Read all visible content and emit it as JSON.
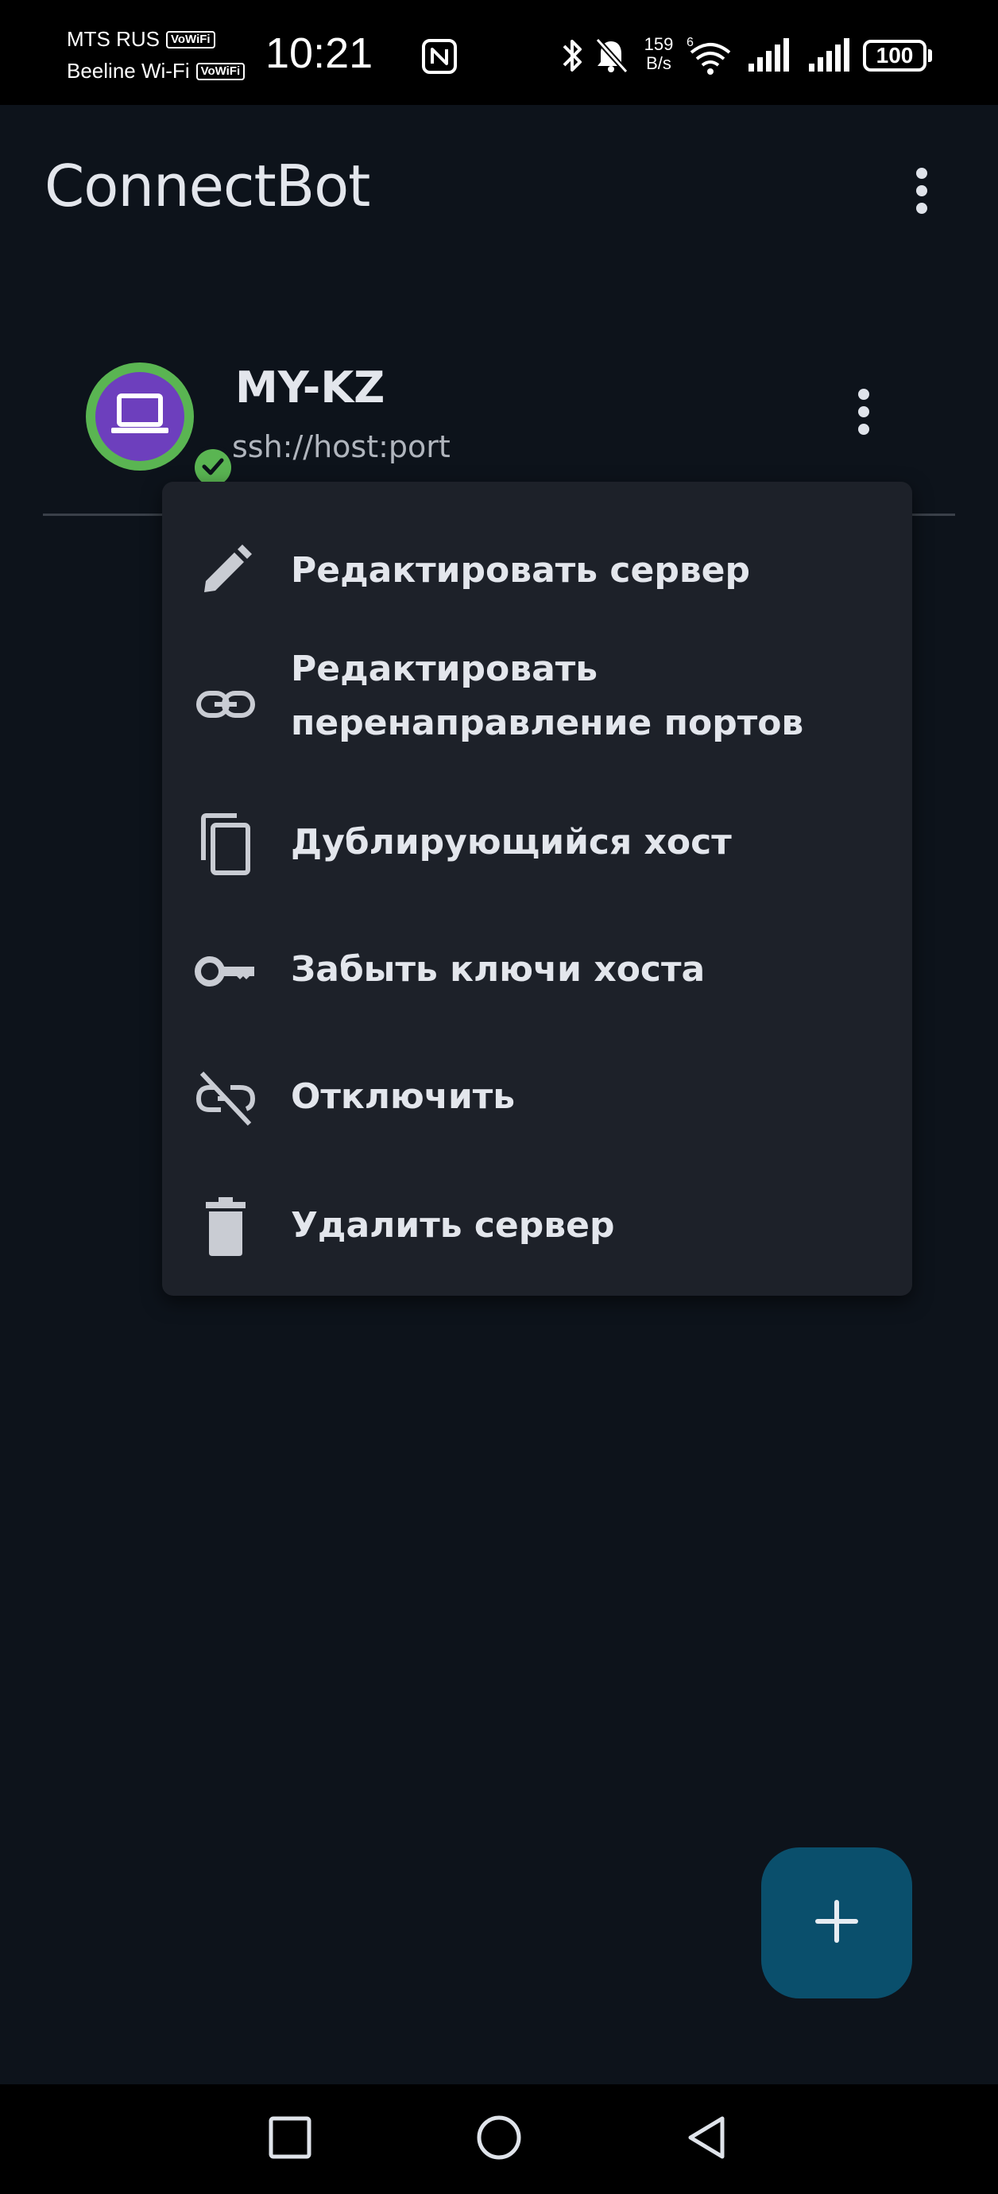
{
  "status_bar": {
    "carrier_1": "MTS RUS",
    "carrier_2": "Beeline Wi-Fi",
    "vowifi_badge": "VoWiFi",
    "time": "10:21",
    "net_speed_value": "159",
    "net_speed_unit": "B/s",
    "wifi_badge": "6",
    "battery": "100"
  },
  "app_bar": {
    "title": "ConnectBot",
    "overflow_icon": "more-vert-icon"
  },
  "host": {
    "name": "MY-KZ",
    "uri": "ssh://host:port",
    "status": "connected",
    "avatar_color": "#6d3fbd",
    "status_color": "#5ab552"
  },
  "context_menu": {
    "items": [
      {
        "label": "Редактировать сервер",
        "icon": "pencil-icon"
      },
      {
        "label": "Редактировать\nперенаправление портов",
        "icon": "link-icon"
      },
      {
        "label": "Дублирующийся хост",
        "icon": "copy-icon"
      },
      {
        "label": "Забыть ключи хоста",
        "icon": "key-icon"
      },
      {
        "label": "Отключить",
        "icon": "link-off-icon"
      },
      {
        "label": "Удалить сервер",
        "icon": "trash-icon"
      }
    ]
  },
  "fab": {
    "icon": "plus-icon",
    "color": "#0a4f6c"
  },
  "nav_bar": {
    "buttons": [
      "recents-icon",
      "home-icon",
      "back-icon"
    ]
  }
}
